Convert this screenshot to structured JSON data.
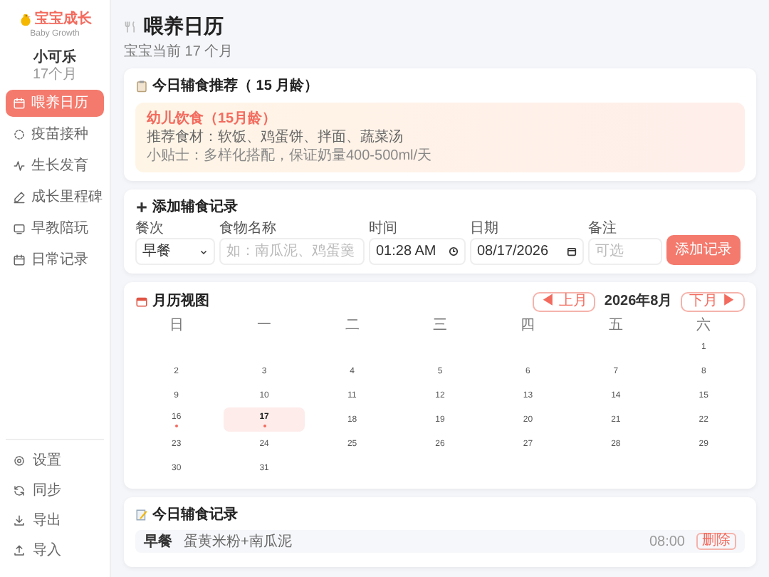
{
  "sidebar": {
    "logo": {
      "title": "宝宝成长",
      "subtitle": "Baby Growth"
    },
    "profile": {
      "name": "小可乐",
      "age": "17个月"
    },
    "nav_items": [
      {
        "label": "喂养日历",
        "selected": true
      },
      {
        "label": "疫苗接种",
        "selected": false
      },
      {
        "label": "生长发育",
        "selected": false
      },
      {
        "label": "成长里程碑",
        "selected": false
      },
      {
        "label": "早教陪玩",
        "selected": false
      },
      {
        "label": "日常记录",
        "selected": false
      }
    ],
    "footer_items": [
      {
        "label": "设置"
      },
      {
        "label": "同步"
      },
      {
        "label": "导出"
      },
      {
        "label": "导入"
      }
    ]
  },
  "header": {
    "title": "喂养日历",
    "subtitle": "宝宝当前 17 个月"
  },
  "recommendation": {
    "title": "今日辅食推荐（ 15 月龄）",
    "stage": "幼儿饮食（15月龄）",
    "foods": "推荐食材：软饭、鸡蛋饼、拌面、蔬菜汤",
    "tip": "小贴士：多样化搭配，保证奶量400-500ml/天"
  },
  "add_form": {
    "title": "添加辅食记录",
    "fields": [
      {
        "kind": "select",
        "label": "餐次",
        "value": "早餐"
      },
      {
        "kind": "text",
        "label": "食物名称",
        "placeholder": "如：南瓜泥、鸡蛋羹"
      },
      {
        "kind": "time",
        "label": "时间",
        "value": "01:28 AM"
      },
      {
        "kind": "date",
        "label": "日期",
        "value": "08/17/2026"
      },
      {
        "kind": "text",
        "label": "备注",
        "placeholder": "可选"
      }
    ],
    "submit": "添加记录"
  },
  "calendar": {
    "title": "月历视图",
    "prev": "◀ 上月",
    "month": "2026年8月",
    "next": "下月 ▶",
    "weekdays": [
      "日",
      "一",
      "二",
      "三",
      "四",
      "五",
      "六"
    ],
    "weeks": [
      {
        "kind": "end",
        "days": [
          {
            "day": "1",
            "selected": false,
            "has_record": false
          }
        ]
      },
      {
        "kind": "full",
        "days": [
          {
            "day": "2",
            "selected": false,
            "has_record": false
          },
          {
            "day": "3",
            "selected": false,
            "has_record": false
          },
          {
            "day": "4",
            "selected": false,
            "has_record": false
          },
          {
            "day": "5",
            "selected": false,
            "has_record": false
          },
          {
            "day": "6",
            "selected": false,
            "has_record": false
          },
          {
            "day": "7",
            "selected": false,
            "has_record": false
          },
          {
            "day": "8",
            "selected": false,
            "has_record": false
          }
        ]
      },
      {
        "kind": "full",
        "days": [
          {
            "day": "9",
            "selected": false,
            "has_record": false
          },
          {
            "day": "10",
            "selected": false,
            "has_record": false
          },
          {
            "day": "11",
            "selected": false,
            "has_record": false
          },
          {
            "day": "12",
            "selected": false,
            "has_record": false
          },
          {
            "day": "13",
            "selected": false,
            "has_record": false
          },
          {
            "day": "14",
            "selected": false,
            "has_record": false
          },
          {
            "day": "15",
            "selected": false,
            "has_record": false
          }
        ]
      },
      {
        "kind": "full",
        "days": [
          {
            "day": "16",
            "selected": false,
            "has_record": true
          },
          {
            "day": "17",
            "selected": true,
            "has_record": true
          },
          {
            "day": "18",
            "selected": false,
            "has_record": false
          },
          {
            "day": "19",
            "selected": false,
            "has_record": false
          },
          {
            "day": "20",
            "selected": false,
            "has_record": false
          },
          {
            "day": "21",
            "selected": false,
            "has_record": false
          },
          {
            "day": "22",
            "selected": false,
            "has_record": false
          }
        ]
      },
      {
        "kind": "full",
        "days": [
          {
            "day": "23",
            "selected": false,
            "has_record": false
          },
          {
            "day": "24",
            "selected": false,
            "has_record": false
          },
          {
            "day": "25",
            "selected": false,
            "has_record": false
          },
          {
            "day": "26",
            "selected": false,
            "has_record": false
          },
          {
            "day": "27",
            "selected": false,
            "has_record": false
          },
          {
            "day": "28",
            "selected": false,
            "has_record": false
          },
          {
            "day": "29",
            "selected": false,
            "has_record": false
          }
        ]
      },
      {
        "kind": "start",
        "days": [
          {
            "day": "30",
            "selected": false,
            "has_record": false
          },
          {
            "day": "31",
            "selected": false,
            "has_record": false
          }
        ]
      }
    ]
  },
  "records": {
    "title": "今日辅食记录",
    "rows": [
      {
        "meal": "早餐",
        "food": "蛋黄米粉+南瓜泥",
        "time": "08:00",
        "action": "删除"
      }
    ]
  }
}
